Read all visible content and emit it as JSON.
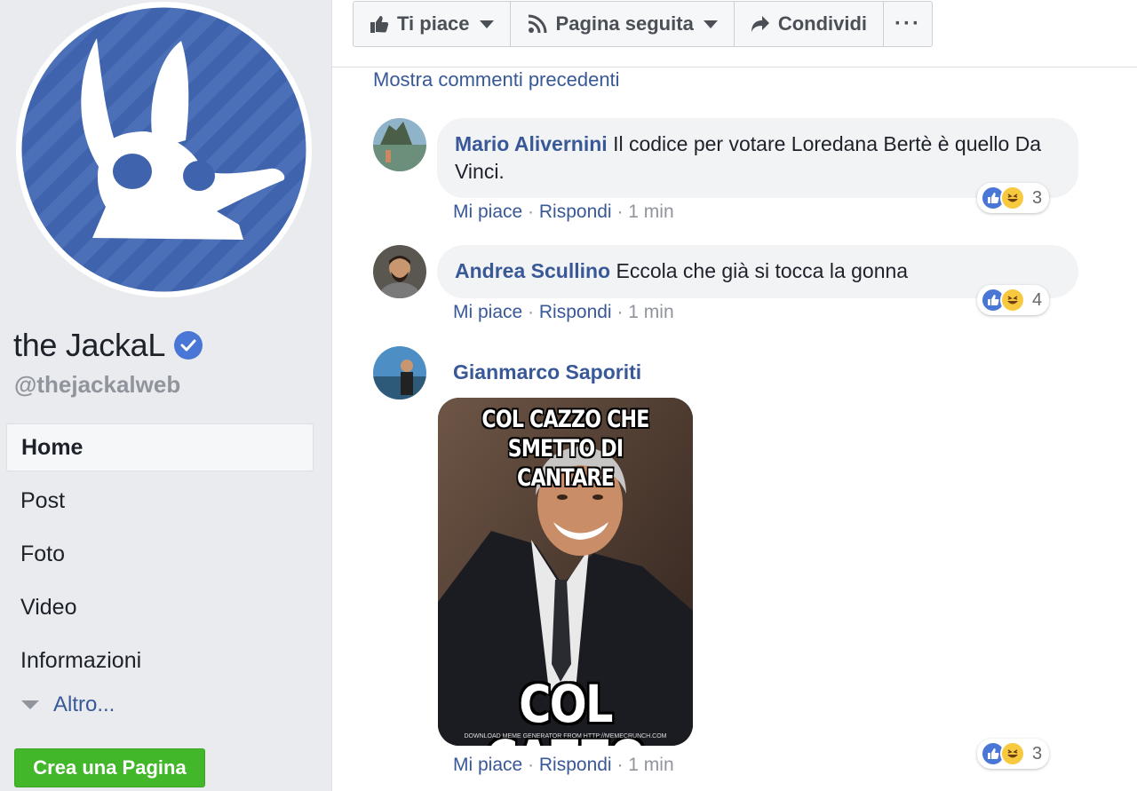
{
  "sidebar": {
    "page_name": "the JackaL",
    "handle": "@thejackalweb",
    "nav": [
      {
        "label": "Home",
        "active": true
      },
      {
        "label": "Post",
        "active": false
      },
      {
        "label": "Foto",
        "active": false
      },
      {
        "label": "Video",
        "active": false
      },
      {
        "label": "Informazioni",
        "active": false
      }
    ],
    "more_label": "Altro...",
    "create_page_label": "Crea una Pagina"
  },
  "actions": {
    "like_label": "Ti piace",
    "follow_label": "Pagina seguita",
    "share_label": "Condividi",
    "more_label": "···"
  },
  "comments_section": {
    "show_previous": "Mostra commenti precedenti",
    "comments": [
      {
        "author": "Mario Alivernini",
        "text": "Il codice per votare Loredana Bertè è quello Da Vinci.",
        "like_label": "Mi piace",
        "reply_label": "Rispondi",
        "time": "1 min",
        "reaction_count": "3"
      },
      {
        "author": "Andrea Scullino",
        "text": "Eccola che già si tocca la gonna",
        "like_label": "Mi piace",
        "reply_label": "Rispondi",
        "time": "1 min",
        "reaction_count": "4"
      },
      {
        "author": "Gianmarco Saporiti",
        "text": "",
        "meme_top": "COL CAZZO CHE SMETTO DI CANTARE",
        "meme_bottom": "COL CAZZO",
        "meme_credit": "DOWNLOAD MEME GENERATOR FROM HTTP://MEMECRUNCH.COM",
        "like_label": "Mi piace",
        "reply_label": "Rispondi",
        "time": "1 min",
        "reaction_count": "3"
      }
    ]
  },
  "colors": {
    "link": "#385898",
    "brand_blue": "#4a76d6",
    "create_green": "#42b72a",
    "sidebar_bg": "#e9ebee"
  },
  "icons": [
    "like-thumb-icon",
    "rss-follow-icon",
    "share-arrow-icon",
    "more-dots-icon",
    "verified-badge-icon",
    "like-reaction-icon",
    "haha-reaction-icon",
    "dropdown-triangle-icon"
  ]
}
